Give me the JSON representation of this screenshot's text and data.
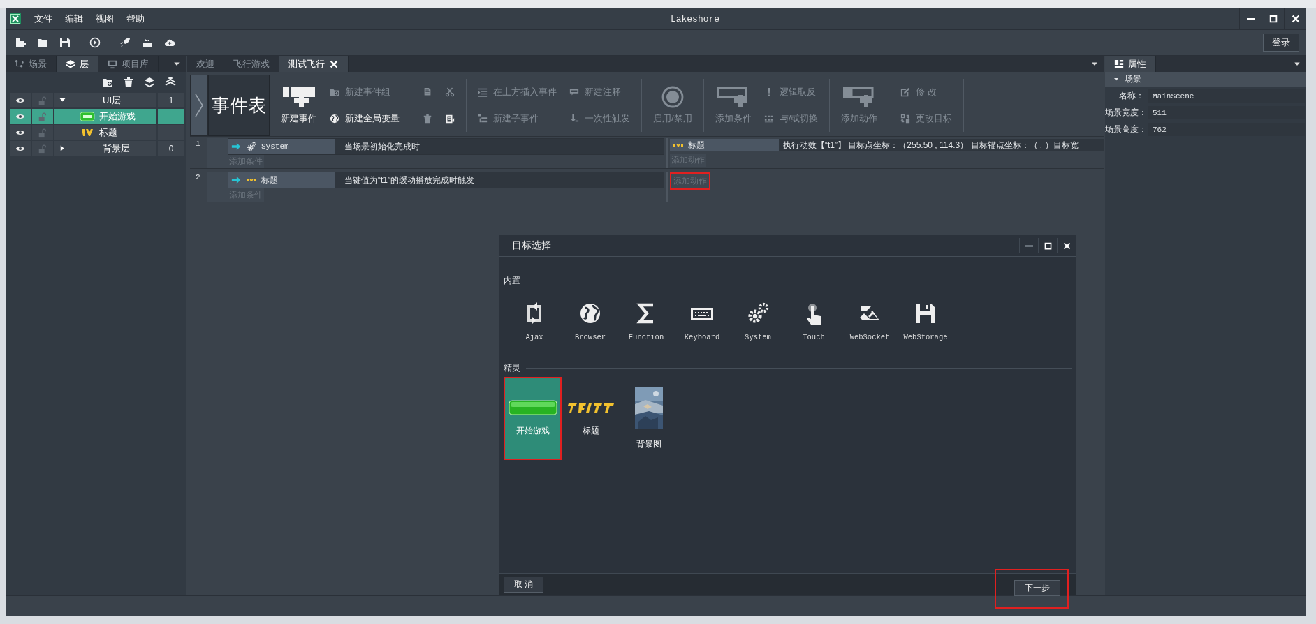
{
  "window": {
    "title": "Lakeshore",
    "menu": [
      "文件",
      "编辑",
      "视图",
      "帮助"
    ],
    "login_button": "登录"
  },
  "left_panel": {
    "tabs": [
      {
        "label": "场景",
        "selected": false
      },
      {
        "label": "层",
        "selected": true
      },
      {
        "label": "项目库",
        "selected": false
      }
    ],
    "layers": [
      {
        "name": "UI层",
        "count": "1",
        "expanded": true,
        "selected": false,
        "children": [
          {
            "name": "开始游戏",
            "kind": "button",
            "selected": true
          },
          {
            "name": "标题",
            "kind": "title",
            "selected": false
          }
        ]
      },
      {
        "name": "背景层",
        "count": "0",
        "expanded": false,
        "selected": false
      }
    ]
  },
  "editor_tabs": [
    {
      "label": "欢迎",
      "selected": false
    },
    {
      "label": "飞行游戏",
      "selected": false
    },
    {
      "label": "测试飞行",
      "selected": true
    }
  ],
  "event_toolbar": {
    "title": "事件表",
    "groups": [
      [
        [
          {
            "kind": "large",
            "label": "新建事件",
            "disabled": false
          }
        ],
        [
          {
            "kind": "small",
            "label": "新建事件组",
            "disabled": true
          },
          {
            "kind": "small",
            "label": "新建全局变量",
            "disabled": false
          }
        ]
      ],
      [
        [
          {
            "kind": "icon",
            "disabled": true
          },
          {
            "kind": "icon",
            "disabled": true
          }
        ],
        [
          {
            "kind": "icon",
            "disabled": true
          },
          {
            "kind": "icon",
            "disabled": false
          }
        ]
      ],
      [
        [
          {
            "kind": "small",
            "label": "在上方插入事件",
            "disabled": true
          },
          {
            "kind": "small",
            "label": "新建子事件",
            "disabled": true
          }
        ],
        [
          {
            "kind": "small",
            "label": "新建注释",
            "disabled": true
          },
          {
            "kind": "small",
            "label": "一次性触发",
            "disabled": true
          }
        ]
      ],
      [
        [
          {
            "kind": "large",
            "label": "启用/禁用",
            "disabled": true
          }
        ]
      ],
      [
        [
          {
            "kind": "large",
            "label": "添加条件",
            "disabled": true
          }
        ],
        [
          {
            "kind": "small",
            "label": "逻辑取反",
            "disabled": true
          },
          {
            "kind": "small",
            "label": "与/或切换",
            "disabled": true
          }
        ]
      ],
      [
        [
          {
            "kind": "large",
            "label": "添加动作",
            "disabled": true
          }
        ]
      ],
      [
        [
          {
            "kind": "small",
            "label": "修  改",
            "disabled": true
          },
          {
            "kind": "small",
            "label": "更改目标",
            "disabled": true
          }
        ]
      ]
    ]
  },
  "events": [
    {
      "number": "1",
      "object": "System",
      "kind": "system",
      "condition": "当场景初始化完成时",
      "add_condition": "添加条件",
      "actions": [
        {
          "object": "标题",
          "text": "执行动效【“t1”】 目标点坐标：（255.50 , 114.3） 目标锚点坐标：（ , ）目标宽"
        }
      ],
      "add_action": "添加动作",
      "add_action_highlighted": false
    },
    {
      "number": "2",
      "object": "标题",
      "kind": "sprite",
      "condition": "当键值为“t1”的缓动播放完成时触发",
      "add_condition": "添加条件",
      "add_action": "添加动作",
      "add_action_highlighted": true
    }
  ],
  "properties_panel": {
    "tab": {
      "label": "属性",
      "selected": true
    },
    "section": {
      "title": "场景",
      "expanded": true
    },
    "rows": [
      {
        "label": "名称：",
        "value": "MainScene"
      },
      {
        "label": "场景宽度：",
        "value": "511"
      },
      {
        "label": "场景高度：",
        "value": "762"
      }
    ]
  },
  "dialog": {
    "title": "目标选择",
    "builtin": {
      "title": "内置",
      "items": [
        {
          "label": "Ajax",
          "kind": "ajax"
        },
        {
          "label": "Browser",
          "kind": "browser"
        },
        {
          "label": "Function",
          "kind": "function"
        },
        {
          "label": "Keyboard",
          "kind": "keyboard"
        },
        {
          "label": "System",
          "kind": "system"
        },
        {
          "label": "Touch",
          "kind": "touch"
        },
        {
          "label": "WebSocket",
          "kind": "websocket"
        },
        {
          "label": "WebStorage",
          "kind": "webstorage"
        }
      ]
    },
    "sprites": {
      "title": "精灵",
      "items": [
        {
          "label": "开始游戏",
          "kind": "button",
          "selected": true,
          "highlighted": true
        },
        {
          "label": "标题",
          "kind": "title",
          "selected": false,
          "highlighted": false
        },
        {
          "label": "背景图",
          "kind": "picture",
          "selected": false,
          "highlighted": false
        }
      ]
    },
    "cancel_button": "取  消",
    "next_button": {
      "label": "下一步",
      "highlighted": true
    }
  }
}
